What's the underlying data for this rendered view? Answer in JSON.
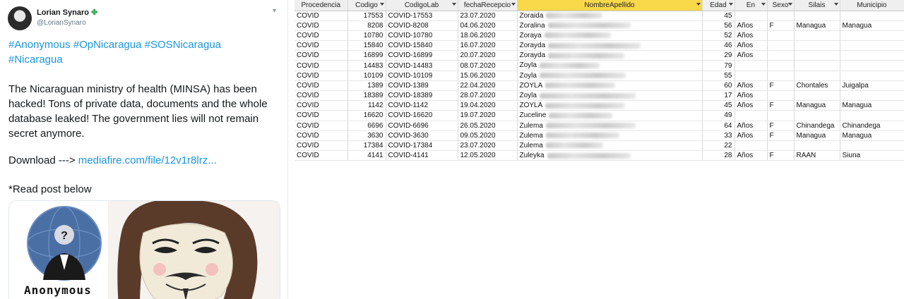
{
  "tweet": {
    "display_name": "Lorian Synaro",
    "handle": "@LorianSynaro",
    "hashtags_line1": "#Anonymous #OpNicaragua #SOSNicaragua",
    "hashtags_line2": "#Nicaragua",
    "body_lines": [
      "The Nicaraguan ministry of health (MINSA) has been",
      "hacked! Tons of private data, documents and the whole",
      "database leaked! The government lies will not remain",
      "secret anymore."
    ],
    "download_label": "Download --->",
    "download_link": "mediafire.com/file/12v1r8lrz...",
    "read_post": "*Read post below",
    "image_logo_text": "Anonymous"
  },
  "sheet": {
    "columns": [
      "Procedencia",
      "Codigo",
      "CodigoLab",
      "fechaRecepcio",
      "NombreApellido",
      "Edad",
      "En",
      "Sexo",
      "Silais",
      "Municipio"
    ],
    "rows": [
      {
        "proc": "COVID",
        "codigo": "17553",
        "lab": "COVID-17553",
        "fecha": "23.07.2020",
        "nombre": "Zoraida",
        "edad": "45",
        "en": "",
        "sexo": "",
        "silais": "",
        "muni": ""
      },
      {
        "proc": "COVID",
        "codigo": "8208",
        "lab": "COVID-8208",
        "fecha": "04.06.2020",
        "nombre": "Zoralina",
        "edad": "56",
        "en": "Años",
        "sexo": "F",
        "silais": "Managua",
        "muni": "Managua"
      },
      {
        "proc": "COVID",
        "codigo": "10780",
        "lab": "COVID-10780",
        "fecha": "18.06.2020",
        "nombre": "Zoraya",
        "edad": "52",
        "en": "Años",
        "sexo": "",
        "silais": "",
        "muni": ""
      },
      {
        "proc": "COVID",
        "codigo": "15840",
        "lab": "COVID-15840",
        "fecha": "16.07.2020",
        "nombre": "Zorayda",
        "edad": "46",
        "en": "Años",
        "sexo": "",
        "silais": "",
        "muni": ""
      },
      {
        "proc": "COVID",
        "codigo": "16899",
        "lab": "COVID-16899",
        "fecha": "20.07.2020",
        "nombre": "Zorayda",
        "edad": "29",
        "en": "Años",
        "sexo": "",
        "silais": "",
        "muni": ""
      },
      {
        "proc": "COVID",
        "codigo": "14483",
        "lab": "COVID-14483",
        "fecha": "08.07.2020",
        "nombre": "Zoyla",
        "edad": "79",
        "en": "",
        "sexo": "",
        "silais": "",
        "muni": ""
      },
      {
        "proc": "COVID",
        "codigo": "10109",
        "lab": "COVID-10109",
        "fecha": "15.06.2020",
        "nombre": "Zoyla",
        "edad": "55",
        "en": "",
        "sexo": "",
        "silais": "",
        "muni": ""
      },
      {
        "proc": "COVID",
        "codigo": "1389",
        "lab": "COVID-1389",
        "fecha": "22.04.2020",
        "nombre": "ZOYLA",
        "edad": "60",
        "en": "Años",
        "sexo": "F",
        "silais": "Chontales",
        "muni": "Juigalpa"
      },
      {
        "proc": "COVID",
        "codigo": "18389",
        "lab": "COVID-18389",
        "fecha": "28.07.2020",
        "nombre": "Zoyla",
        "edad": "17",
        "en": "Años",
        "sexo": "",
        "silais": "",
        "muni": ""
      },
      {
        "proc": "COVID",
        "codigo": "1142",
        "lab": "COVID-1142",
        "fecha": "19.04.2020",
        "nombre": "ZOYLA",
        "edad": "45",
        "en": "Años",
        "sexo": "F",
        "silais": "Managua",
        "muni": "Managua"
      },
      {
        "proc": "COVID",
        "codigo": "16620",
        "lab": "COVID-16620",
        "fecha": "19.07.2020",
        "nombre": "Zuceline",
        "edad": "49",
        "en": "",
        "sexo": "",
        "silais": "",
        "muni": ""
      },
      {
        "proc": "COVID",
        "codigo": "6696",
        "lab": "COVID-6696",
        "fecha": "26.05.2020",
        "nombre": "Zulema",
        "edad": "64",
        "en": "Años",
        "sexo": "F",
        "silais": "Chinandega",
        "muni": "Chinandega"
      },
      {
        "proc": "COVID",
        "codigo": "3630",
        "lab": "COVID-3630",
        "fecha": "09.05.2020",
        "nombre": "Zulema",
        "edad": "33",
        "en": "Años",
        "sexo": "F",
        "silais": "Managua",
        "muni": "Managua"
      },
      {
        "proc": "COVID",
        "codigo": "17384",
        "lab": "COVID-17384",
        "fecha": "23.07.2020",
        "nombre": "Zulema",
        "edad": "22",
        "en": "",
        "sexo": "",
        "silais": "",
        "muni": ""
      },
      {
        "proc": "COVID",
        "codigo": "4141",
        "lab": "COVID-4141",
        "fecha": "12.05.2020",
        "nombre": "Zuleyka",
        "edad": "28",
        "en": "Años",
        "sexo": "F",
        "silais": "RAAN",
        "muni": "Siuna"
      }
    ]
  },
  "colors": {
    "link": "#1b95e0",
    "selected_header": "#f9d84a"
  }
}
